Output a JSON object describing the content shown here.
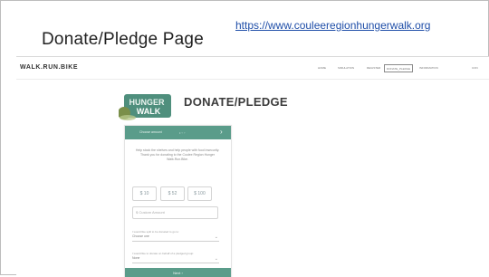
{
  "slide": {
    "title": "Donate/Pledge Page",
    "link": "https://www.couleeregionhungerwalk.org"
  },
  "site": {
    "brand": "WALK.RUN.BIKE",
    "nav": [
      "HOME",
      "SIMULATION",
      "REGISTER",
      "DONATE_PLEDGE",
      "INFORMATION",
      "CON"
    ],
    "active_nav": "DONATE_PLEDGE",
    "logo_text": [
      "HUNGER",
      "WALK"
    ],
    "page_heading": "DONATE/PLEDGE"
  },
  "panel": {
    "head_label": "Choose amount",
    "head_dots": "• ◦ ◦",
    "head_arrow": "›",
    "intro": "Help stock the shelves and help people with food insecurity. Thank you for donating to the Coulee Region Hunger Walk.Run.Bike.",
    "amounts": [
      "$ 10",
      "$ 52",
      "$ 100"
    ],
    "custom_placeholder": "$ Custom Amount",
    "question1": "I would like split to be donated to go to:",
    "select1": "Choose one",
    "question2": "I would like to donate on behalf of a pledged group:",
    "select2": "None",
    "next_label": "Next ›",
    "accent": "#5a9c8a"
  }
}
